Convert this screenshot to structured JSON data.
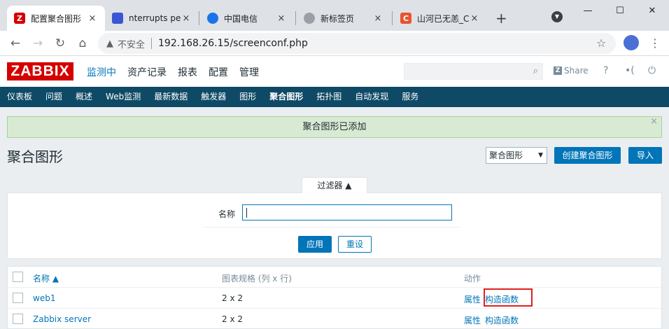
{
  "browser": {
    "tabs": [
      {
        "title": "配置聚合图形",
        "favicon_letter": "Z",
        "favicon_color": "#d40000",
        "active": true
      },
      {
        "title": "nterrupts pe",
        "favicon_letter": "",
        "favicon_color": "#3a56d4",
        "active": false
      },
      {
        "title": "中国电信",
        "favicon_letter": "",
        "favicon_color": "#1a73e8",
        "active": false
      },
      {
        "title": "新标签页",
        "favicon_letter": "",
        "favicon_color": "#5f6368",
        "active": false
      },
      {
        "title": "山河已无恙_C",
        "favicon_letter": "C",
        "favicon_color": "#e8542d",
        "active": false
      }
    ],
    "new_tab": "+",
    "close_glyph": "×",
    "window_controls": {
      "minimize": "—",
      "maximize": "☐",
      "close": "✕"
    },
    "insecure_label": "不安全",
    "url": "192.168.26.15/screenconf.php"
  },
  "zabbix": {
    "logo": "ZABBIX",
    "main_menu": [
      {
        "label": "监测中",
        "active": true
      },
      {
        "label": "资产记录",
        "active": false
      },
      {
        "label": "报表",
        "active": false
      },
      {
        "label": "配置",
        "active": false
      },
      {
        "label": "管理",
        "active": false
      }
    ],
    "share_label": "Share",
    "help_glyph": "?",
    "sub_menu": [
      {
        "label": "仪表板",
        "active": false
      },
      {
        "label": "问题",
        "active": false
      },
      {
        "label": "概述",
        "active": false
      },
      {
        "label": "Web监测",
        "active": false
      },
      {
        "label": "最新数据",
        "active": false
      },
      {
        "label": "触发器",
        "active": false
      },
      {
        "label": "图形",
        "active": false
      },
      {
        "label": "聚合图形",
        "active": true
      },
      {
        "label": "拓扑图",
        "active": false
      },
      {
        "label": "自动发现",
        "active": false
      },
      {
        "label": "服务",
        "active": false
      }
    ],
    "message": "聚合图形已添加",
    "page_title": "聚合图形",
    "type_select": "聚合图形",
    "create_button": "创建聚合图形",
    "import_button": "导入",
    "filter": {
      "tab_label": "过滤器 ▲",
      "name_label": "名称",
      "name_value": "",
      "apply": "应用",
      "reset": "重设"
    },
    "table": {
      "headers": {
        "name": "名称 ▲",
        "dimension": "图表规格 (列 x 行)",
        "actions": "动作"
      },
      "rows": [
        {
          "name": "web1",
          "dimension": "2 x 2",
          "action_props": "属性",
          "action_constructor": "构造函数"
        },
        {
          "name": "Zabbix server",
          "dimension": "2 x 2",
          "action_props": "属性",
          "action_constructor": "构造函数"
        }
      ]
    },
    "colors": {
      "brand": "#d40000",
      "nav_bg": "#0e4a66",
      "link": "#0275b8",
      "success_bg": "#d9ead3",
      "highlight": "#e02020"
    }
  }
}
